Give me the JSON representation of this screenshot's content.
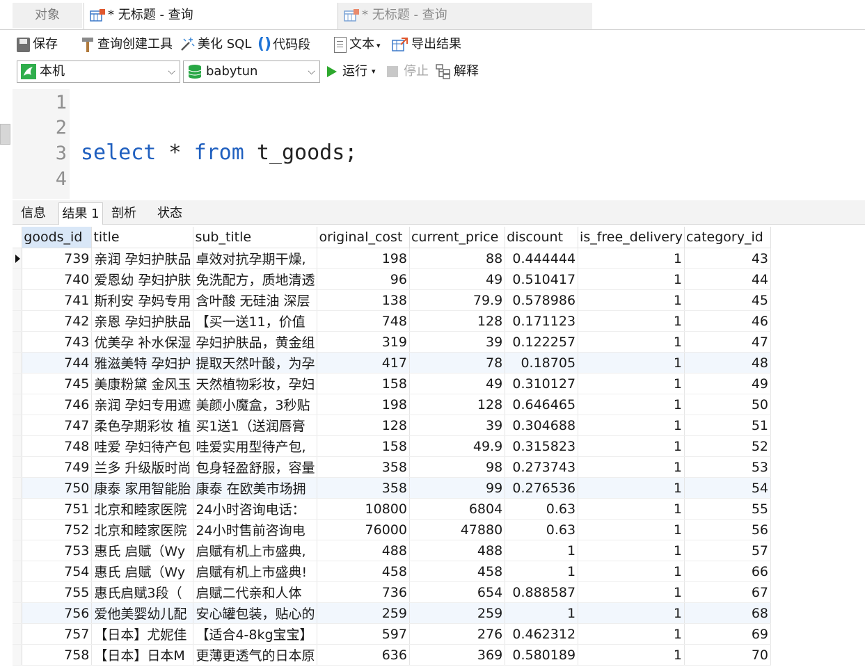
{
  "tabs": {
    "objects": "对象",
    "query1": "* 无标题 - 查询",
    "query2": "* 无标题 - 查询"
  },
  "toolbar": {
    "save": "保存",
    "query_builder": "查询创建工具",
    "beautify_sql": "美化 SQL",
    "code_snippet": "代码段",
    "text": "文本",
    "export_results": "导出结果"
  },
  "connection": {
    "selected": "本机",
    "database": "babytun",
    "run": "运行",
    "stop": "停止",
    "explain": "解释"
  },
  "editor": {
    "line_numbers": [
      "1",
      "2",
      "3",
      "4"
    ],
    "keyword_select": "select",
    "star": " * ",
    "keyword_from": "from",
    "table_part": " t_goods;"
  },
  "result_tabs": [
    "信息",
    "结果 1",
    "剖析",
    "状态"
  ],
  "grid": {
    "columns": [
      "goods_id",
      "title",
      "sub_title",
      "original_cost",
      "current_price",
      "discount",
      "is_free_delivery",
      "category_id"
    ],
    "rows": [
      [
        "739",
        "亲润 孕妇护肤品",
        "卓效对抗孕期干燥,",
        "198",
        "88",
        "0.444444",
        "1",
        "43"
      ],
      [
        "740",
        "爱恩幼 孕妇护肤",
        "免洗配方，质地清透",
        "96",
        "49",
        "0.510417",
        "1",
        "44"
      ],
      [
        "741",
        "斯利安 孕妈专用",
        "含叶酸 无硅油 深层",
        "138",
        "79.9",
        "0.578986",
        "1",
        "45"
      ],
      [
        "742",
        "亲恩 孕妇护肤品",
        "【买一送11，价值",
        "748",
        "128",
        "0.171123",
        "1",
        "46"
      ],
      [
        "743",
        "优美孕 补水保湿",
        "孕妇护肤品，黄金组",
        "319",
        "39",
        "0.122257",
        "1",
        "47"
      ],
      [
        "744",
        "雅滋美特 孕妇护",
        "提取天然叶酸，为孕",
        "417",
        "78",
        "0.18705",
        "1",
        "48"
      ],
      [
        "745",
        "美康粉黛 金风玉",
        "天然植物彩妆，孕妇",
        "158",
        "49",
        "0.310127",
        "1",
        "49"
      ],
      [
        "746",
        "亲润 孕妇专用遮",
        "美颜小魔盒，3秒贴",
        "198",
        "128",
        "0.646465",
        "1",
        "50"
      ],
      [
        "747",
        "柔色孕期彩妆 植",
        "买1送1（送润唇膏",
        "128",
        "39",
        "0.304688",
        "1",
        "51"
      ],
      [
        "748",
        "哇爱 孕妇待产包",
        "哇爱实用型待产包,",
        "158",
        "49.9",
        "0.315823",
        "1",
        "52"
      ],
      [
        "749",
        "兰多 升级版时尚",
        "包身轻盈舒服，容量",
        "358",
        "98",
        "0.273743",
        "1",
        "53"
      ],
      [
        "750",
        "康泰 家用智能胎",
        "康泰 在欧美市场拥",
        "358",
        "99",
        "0.276536",
        "1",
        "54"
      ],
      [
        "751",
        "北京和睦家医院",
        "24小时咨询电话：",
        "10800",
        "6804",
        "0.63",
        "1",
        "55"
      ],
      [
        "752",
        "北京和睦家医院",
        "24小时售前咨询电",
        "76000",
        "47880",
        "0.63",
        "1",
        "56"
      ],
      [
        "753",
        "惠氏 启赋（Wy",
        "启赋有机上市盛典,",
        "488",
        "488",
        "1",
        "1",
        "57"
      ],
      [
        "754",
        "惠氏 启赋（Wy",
        "启赋有机上市盛典!",
        "458",
        "458",
        "1",
        "1",
        "66"
      ],
      [
        "755",
        "惠氏启赋3段（",
        "启赋二代亲和人体",
        "736",
        "654",
        "0.888587",
        "1",
        "67"
      ],
      [
        "756",
        "爱他美婴幼儿配",
        "安心罐包装，贴心的",
        "259",
        "259",
        "1",
        "1",
        "68"
      ],
      [
        "757",
        "【日本】尤妮佳",
        "【适合4-8kg宝宝】",
        "597",
        "276",
        "0.462312",
        "1",
        "69"
      ],
      [
        "758",
        "【日本】日本M",
        "更薄更透气的日本原",
        "636",
        "369",
        "0.580189",
        "1",
        "70"
      ]
    ]
  },
  "colors": {
    "keyword": "#1f5fbf",
    "run_green": "#2da82d",
    "header_selected": "#d9e7f7",
    "row_highlight": "#f2f7fd"
  }
}
